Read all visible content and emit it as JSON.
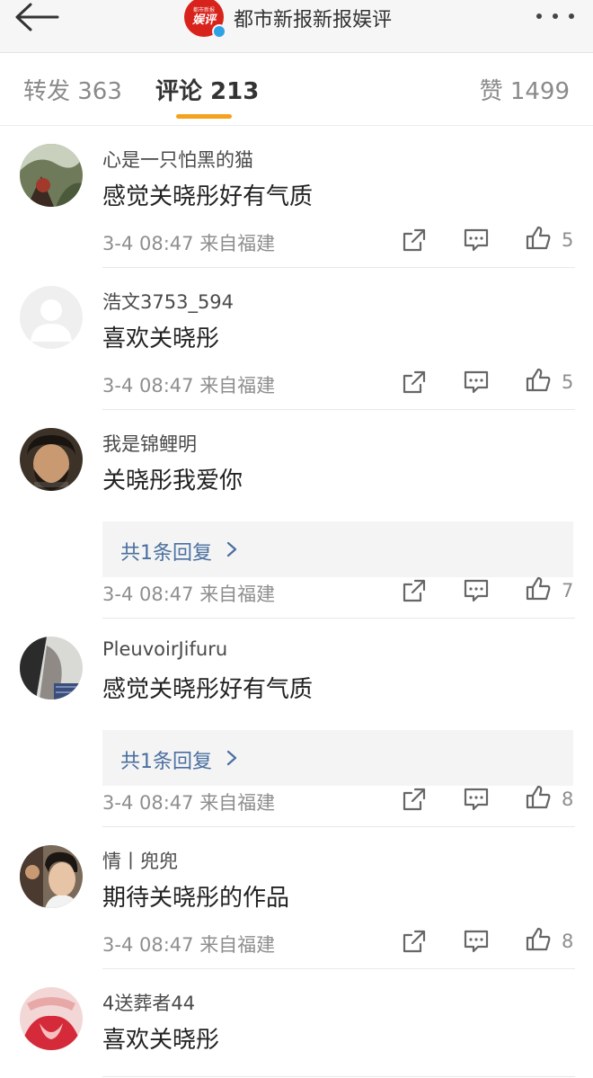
{
  "header": {
    "title": "都市新报新报娱评",
    "logo_small_text": "都市新报",
    "logo_text": "娱评"
  },
  "tabs": {
    "repost": "转发 363",
    "comment": "评论 213",
    "like": "赞 1499"
  },
  "colors": {
    "accent": "#f5a11c",
    "brand": "#d8231c",
    "reply_link": "#4a6fa0"
  },
  "comments": [
    {
      "username": "心是一只怕黑的猫",
      "text": "感觉关晓彤好有气质",
      "time": "3-4 08:47",
      "source": "来自福建",
      "likes": "5",
      "reply": ""
    },
    {
      "username": "浩文3753_594",
      "text": "喜欢关晓彤",
      "time": "3-4 08:47",
      "source": "来自福建",
      "likes": "5",
      "reply": ""
    },
    {
      "username": "我是锦鲤明",
      "text": "关晓彤我爱你",
      "time": "3-4 08:47",
      "source": "来自福建",
      "likes": "7",
      "reply": "共1条回复"
    },
    {
      "username": "PleuvoirJifuru",
      "text": "感觉关晓彤好有气质",
      "time": "3-4 08:47",
      "source": "来自福建",
      "likes": "8",
      "reply": "共1条回复"
    },
    {
      "username": "情丨兜兜",
      "text": "期待关晓彤的作品",
      "time": "3-4 08:47",
      "source": "来自福建",
      "likes": "8",
      "reply": ""
    },
    {
      "username": "4送葬者44",
      "text": "喜欢关晓彤",
      "time": "",
      "source": "",
      "likes": "",
      "reply": ""
    }
  ],
  "icons": [
    "back-arrow-icon",
    "more-dots-icon",
    "share-icon",
    "comment-icon",
    "thumbs-up-icon",
    "chevron-right-icon"
  ]
}
